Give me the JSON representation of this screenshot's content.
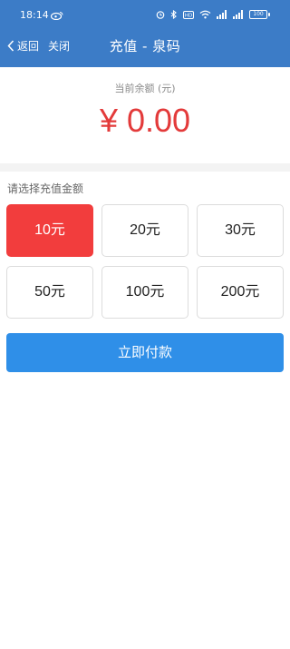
{
  "status_bar": {
    "time": "18:14",
    "battery": "100",
    "icons": [
      "weibo-icon",
      "alarm-icon",
      "bluetooth-icon",
      "hd-icon",
      "wifi-icon",
      "signal-icon",
      "signal-icon",
      "battery-icon"
    ]
  },
  "nav": {
    "back_label": "返回",
    "close_label": "关闭",
    "title": "充值 - 泉码"
  },
  "balance": {
    "label": "当前余额 (元)",
    "amount": "¥ 0.00"
  },
  "recharge": {
    "section_title": "请选择充值金额",
    "options": [
      {
        "label": "10元",
        "selected": true
      },
      {
        "label": "20元",
        "selected": false
      },
      {
        "label": "30元",
        "selected": false
      },
      {
        "label": "50元",
        "selected": false
      },
      {
        "label": "100元",
        "selected": false
      },
      {
        "label": "200元",
        "selected": false
      }
    ]
  },
  "pay_button_label": "立即付款",
  "colors": {
    "header": "#3c7cc7",
    "amount": "#e33a3a",
    "selected_option": "#f23d3d",
    "pay_button": "#2f8fe8"
  }
}
